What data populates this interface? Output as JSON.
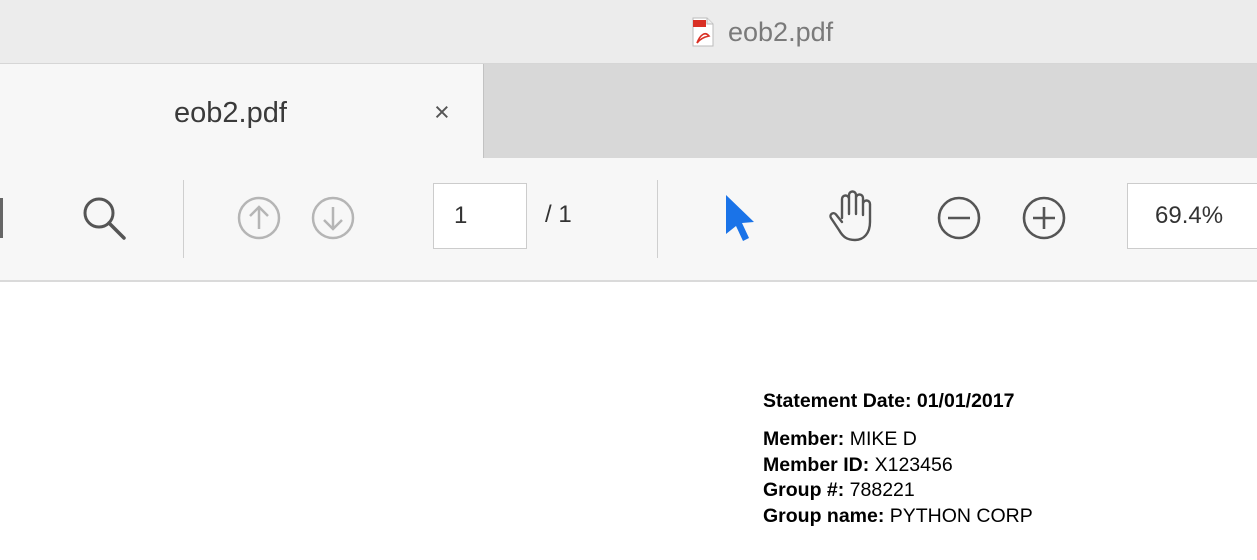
{
  "window": {
    "title": "eob2.pdf",
    "icon": "pdf-document-icon"
  },
  "tabs": [
    {
      "label": "eob2.pdf",
      "close_label": "×",
      "active": true
    }
  ],
  "toolbar": {
    "icons": [
      "search-icon",
      "page-up-icon",
      "page-down-icon",
      "select-cursor-icon",
      "hand-tool-icon",
      "zoom-out-icon",
      "zoom-in-icon"
    ],
    "page_current": "1",
    "page_total": "/ 1",
    "zoom": "69.4%",
    "accent_color": "#1a73e8"
  },
  "document": {
    "statement_date": "Statement Date: 01/01/2017",
    "fields": [
      {
        "label": "Member:",
        "value": " MIKE D"
      },
      {
        "label": "Member ID:",
        "value": " X123456"
      },
      {
        "label": "Group #:",
        "value": " 788221"
      },
      {
        "label": "Group name:",
        "value": " PYTHON CORP"
      }
    ]
  }
}
